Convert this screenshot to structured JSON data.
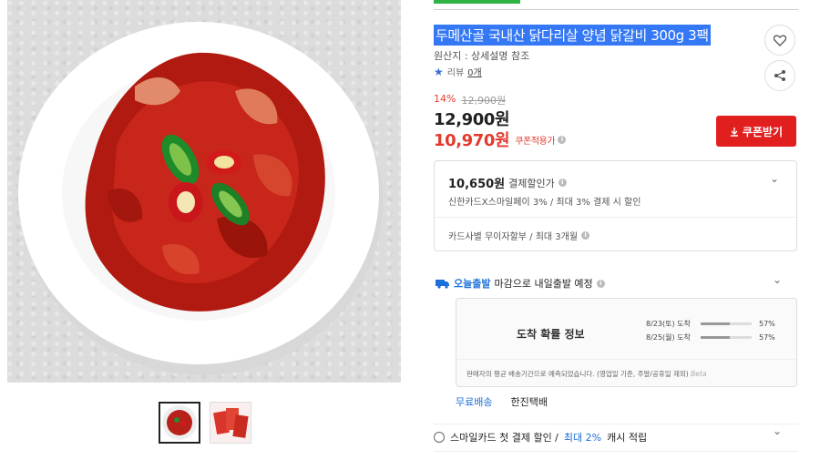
{
  "product": {
    "title": "두메산골 국내산 닭다리살 양념 닭갈비 300g 3팩",
    "origin": "원산지 : 상세설명 참조",
    "review_label": "리뷰",
    "review_count": "0개"
  },
  "price": {
    "discount_rate": "14%",
    "original": "12,900원",
    "current": "12,900원",
    "coupon_price": "10,970원",
    "coupon_note": "쿠폰적용가",
    "coupon_button": "쿠폰받기"
  },
  "payment": {
    "amount": "10,650원",
    "label": "결제할인가",
    "detail": "신한카드X스마일페이 3% / 최대 3% 결제 시 할인",
    "installment": "카드사별 무이자할부 / 최대 3개월"
  },
  "shipping": {
    "today_label": "오늘출발",
    "deadline_text": "마감으로 내일출발 예정",
    "arrival_title": "도착 확률 정보",
    "arrivals": [
      {
        "date": "8/23(토) 도착",
        "percent": "57%",
        "fill": 57
      },
      {
        "date": "8/25(월) 도착",
        "percent": "57%",
        "fill": 57
      }
    ],
    "note": "판매자의 평균 배송기간으로 예측되었습니다. (영업일 기준, 주말/공휴일 제외)",
    "beta": "Beta",
    "free_shipping": "무료배송",
    "carrier": "한진택배"
  },
  "smilecard": {
    "text": "스마일카드 첫 결제 할인 /",
    "accent": "최대 2%",
    "suffix": "캐시 적립"
  },
  "colors": {
    "accent_red": "#e11f1f",
    "link_blue": "#1c6fd8",
    "selection_blue": "#3478f6"
  }
}
